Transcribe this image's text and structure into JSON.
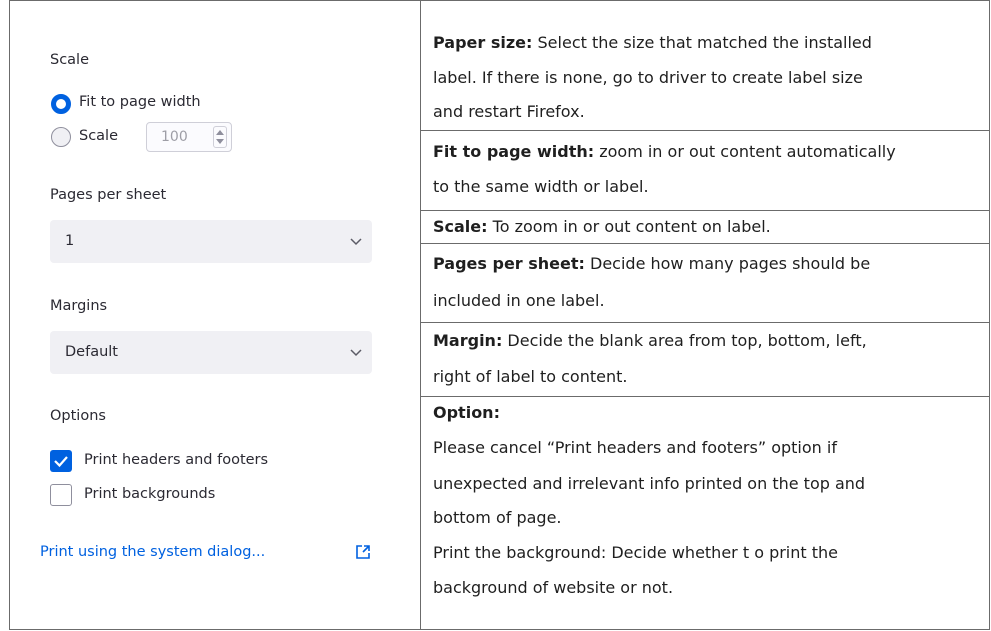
{
  "settings": {
    "scale": {
      "heading": "Scale",
      "fit_label": "Fit to page width",
      "scale_label": "Scale",
      "scale_value": "100",
      "selected": "fit"
    },
    "pages_per_sheet": {
      "heading": "Pages per sheet",
      "value": "1"
    },
    "margins": {
      "heading": "Margins",
      "value": "Default"
    },
    "options": {
      "heading": "Options",
      "headers_footers_label": "Print headers and footers",
      "headers_footers_checked": true,
      "backgrounds_label": "Print backgrounds",
      "backgrounds_checked": false
    },
    "system_dialog_link": "Print using the system dialog..."
  },
  "colors": {
    "accent": "#0061e0",
    "border": "#6b6b6b"
  },
  "notes": [
    {
      "title": "Paper size:",
      "lines": [
        " Select the size that matched the installed",
        "label. If there is none, go to driver to create label size",
        "and restart Firefox."
      ]
    },
    {
      "title": "Fit to page width:",
      "lines": [
        " zoom in or out content automatically",
        "to the same width or label."
      ]
    },
    {
      "title": "Scale:",
      "lines": [
        " To zoom in or out content on label."
      ]
    },
    {
      "title": "Pages per sheet:",
      "lines": [
        " Decide how many pages should be",
        "included in one label."
      ]
    },
    {
      "title": "Margin:",
      "lines": [
        " Decide the blank area from top, bottom, left,",
        "right of label to content."
      ]
    },
    {
      "title": "Option:",
      "lines": [
        "",
        "Please cancel “Print headers and footers” option if",
        "unexpected and irrelevant info printed on the top and",
        "bottom of page.",
        "Print the background: Decide whether t o print the",
        "background of website or not."
      ]
    }
  ]
}
